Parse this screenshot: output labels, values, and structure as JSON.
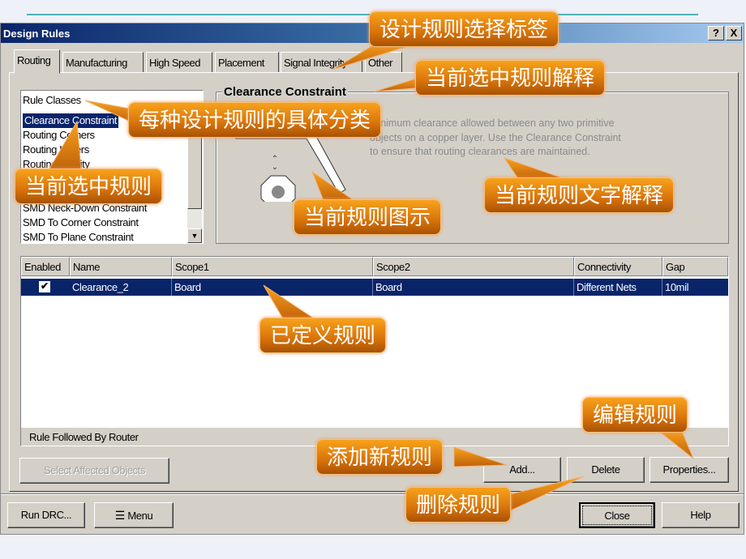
{
  "window": {
    "title": "Design Rules",
    "help_btn": "?",
    "close_btn": "X"
  },
  "tabs": [
    "Routing",
    "Manufacturing",
    "High Speed",
    "Placement",
    "Signal Integrity",
    "Other"
  ],
  "rule_classes": {
    "header": "Rule Classes",
    "items": [
      "Clearance Constraint",
      "Routing Corners",
      "Routing Layers",
      "Routing Priority",
      "SMD Neck-Down Constraint",
      "SMD To Corner Constraint",
      "SMD To Plane Constraint"
    ],
    "selected": "Clearance Constraint"
  },
  "rule_info": {
    "title": "Clearance Constraint",
    "description": "minimum clearance allowed between any two primitive objects on a copper layer. Use the Clearance Constraint to ensure that routing clearances are maintained."
  },
  "table": {
    "columns": [
      "Enabled",
      "Name",
      "Scope1",
      "Scope2",
      "Connectivity",
      "Gap"
    ],
    "rows": [
      {
        "enabled": true,
        "name": "Clearance_2",
        "scope1": "Board",
        "scope2": "Board",
        "connectivity": "Different Nets",
        "gap": "10mil"
      }
    ],
    "footer": "Rule Followed By Router"
  },
  "buttons": {
    "select_affected": "Select Affected Objects",
    "add": "Add...",
    "delete": "Delete",
    "properties": "Properties...",
    "run_drc": "Run DRC...",
    "menu": "Menu",
    "close": "Close",
    "help": "Help"
  },
  "callouts": {
    "tabs": "设计规则选择标签",
    "rule_title": "当前选中规则解释",
    "classes": "每种设计规则的具体分类",
    "selected": "当前选中规则",
    "diagram": "当前规则图示",
    "text": "当前规则文字解释",
    "defined": "已定义规则",
    "edit": "编辑规则",
    "add": "添加新规则",
    "delete": "删除规则"
  },
  "colors": {
    "selection": "#0a246a",
    "callout": "#e8820e",
    "dialog": "#d4d0c8"
  }
}
